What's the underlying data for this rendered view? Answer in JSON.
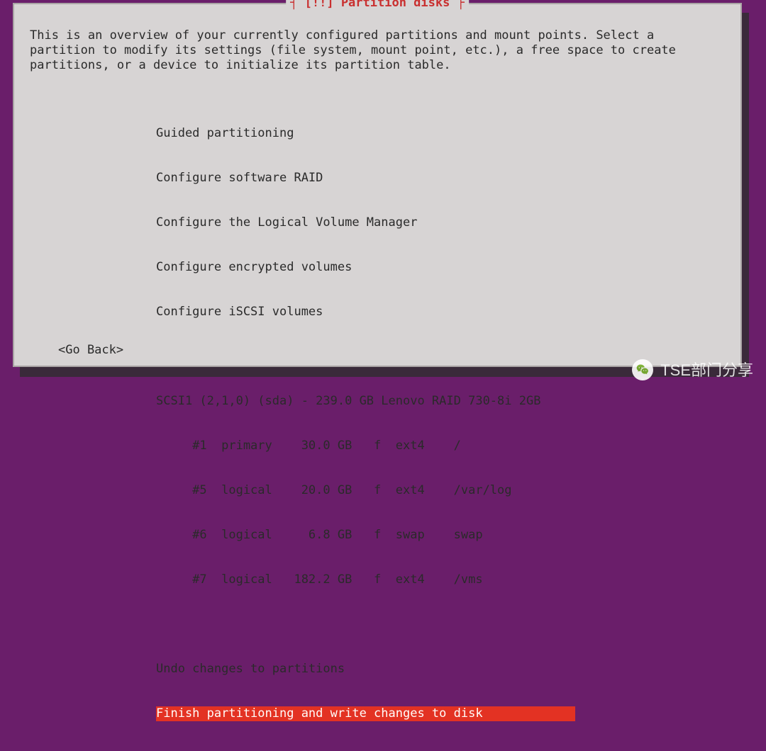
{
  "title": "[!!] Partition disks",
  "intro": "This is an overview of your currently configured partitions and mount points. Select a partition to modify its settings (file system, mount point, etc.), a free space to create partitions, or a device to initialize its partition table.",
  "menu": {
    "guided": "Guided partitioning",
    "raid": "Configure software RAID",
    "lvm": "Configure the Logical Volume Manager",
    "encrypted": "Configure encrypted volumes",
    "iscsi": "Configure iSCSI volumes",
    "disk_header": "SCSI1 (2,1,0) (sda) - 239.0 GB Lenovo RAID 730-8i 2GB",
    "partitions": [
      {
        "num": "#1",
        "type": "primary",
        "size": "30.0 GB",
        "flag": "f",
        "fs": "ext4",
        "mount": "/"
      },
      {
        "num": "#5",
        "type": "logical",
        "size": "20.0 GB",
        "flag": "f",
        "fs": "ext4",
        "mount": "/var/log"
      },
      {
        "num": "#6",
        "type": "logical",
        "size": "6.8 GB",
        "flag": "f",
        "fs": "swap",
        "mount": "swap"
      },
      {
        "num": "#7",
        "type": "logical",
        "size": "182.2 GB",
        "flag": "f",
        "fs": "ext4",
        "mount": "/vms"
      }
    ],
    "undo": "Undo changes to partitions",
    "finish": "Finish partitioning and write changes to disk"
  },
  "go_back": "<Go Back>",
  "watermark": "TSE部门分享"
}
